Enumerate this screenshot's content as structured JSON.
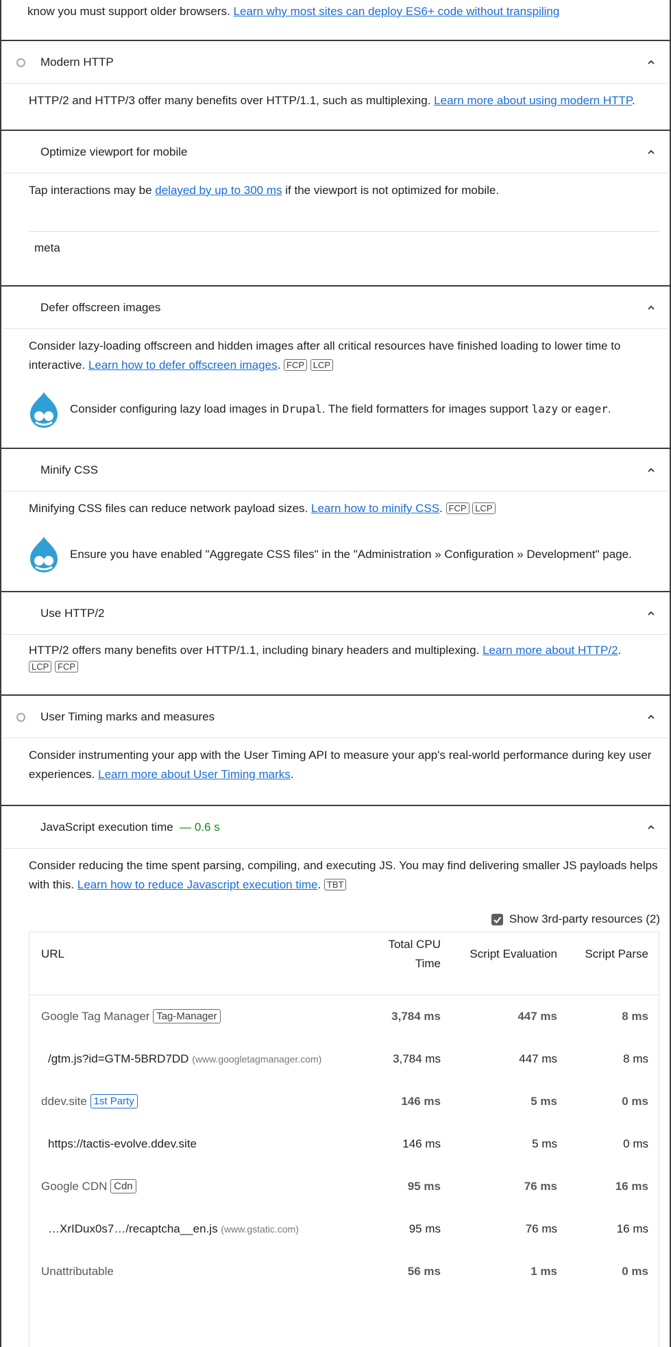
{
  "top": {
    "text": "know you must support older browsers.",
    "link": "Learn why most sites can deploy ES6+ code without transpiling"
  },
  "audits": [
    {
      "title": "Modern HTTP",
      "desc": "HTTP/2 and HTTP/3 offer many benefits over HTTP/1.1, such as multiplexing.",
      "link": "Learn more about using modern HTTP"
    },
    {
      "title": "Optimize viewport for mobile",
      "desc_pre": "Tap interactions may be",
      "link": "delayed by up to 300 ms",
      "desc_post": "if the viewport is not optimized for mobile.",
      "node": "meta"
    },
    {
      "title": "Defer offscreen images",
      "desc": "Consider lazy-loading offscreen and hidden images after all critical resources have finished loading to lower time to interactive.",
      "link": "Learn how to defer offscreen images",
      "chips": [
        "FCP",
        "LCP"
      ],
      "hint_pre": "Consider configuring lazy load images in",
      "hint_code1": "Drupal",
      "hint_mid": ". The field formatters for images support",
      "hint_code2": "lazy",
      "hint_or": "or",
      "hint_code3": "eager"
    },
    {
      "title": "Minify CSS",
      "desc": "Minifying CSS files can reduce network payload sizes.",
      "link": "Learn how to minify CSS",
      "chips": [
        "FCP",
        "LCP"
      ],
      "hint": "Ensure you have enabled \"Aggregate CSS files\" in the \"Administration » Configuration » Development\" page."
    },
    {
      "title": "Use HTTP/2",
      "desc": "HTTP/2 offers many benefits over HTTP/1.1, including binary headers and multiplexing.",
      "link": "Learn more about HTTP/2",
      "chips": [
        "LCP",
        "FCP"
      ]
    },
    {
      "title": "User Timing marks and measures",
      "desc": "Consider instrumenting your app with the User Timing API to measure your app's real-world performance during key user experiences.",
      "link": "Learn more about User Timing marks"
    },
    {
      "title": "JavaScript execution time",
      "value": "— 0.6 s",
      "desc": "Consider reducing the time spent parsing, compiling, and executing JS. You may find delivering smaller JS payloads helps with this.",
      "link": "Learn how to reduce Javascript execution time",
      "chips": [
        "TBT"
      ],
      "third_party_label": "Show 3rd-party resources (2)",
      "third_party_checked": true
    }
  ],
  "table": {
    "headers": {
      "url": "URL",
      "cpu_line1": "Total CPU",
      "cpu_line2": "Time",
      "eval": "Script Evaluation",
      "parse": "Script Parse"
    },
    "rows": [
      {
        "kind": "group",
        "name": "Google Tag Manager",
        "badge": "Tag-Manager",
        "cpu": "3,784 ms",
        "eval": "447 ms",
        "parse": "8 ms"
      },
      {
        "kind": "item",
        "url": "/gtm.js?id=GTM-5BRD7DD",
        "host": "(www.googletagmanager.com)",
        "cpu": "3,784 ms",
        "eval": "447 ms",
        "parse": "8 ms"
      },
      {
        "kind": "group",
        "name": "ddev.site",
        "badge": "1st Party",
        "cpu": "146 ms",
        "eval": "5 ms",
        "parse": "0 ms"
      },
      {
        "kind": "item",
        "url": "https://tactis-evolve.ddev.site",
        "host": "",
        "cpu": "146 ms",
        "eval": "5 ms",
        "parse": "0 ms"
      },
      {
        "kind": "group",
        "name": "Google CDN",
        "badge": "Cdn",
        "cpu": "95 ms",
        "eval": "76 ms",
        "parse": "16 ms"
      },
      {
        "kind": "item",
        "url": "…XrIDux0s7…/recaptcha__en.js",
        "host": "(www.gstatic.com)",
        "cpu": "95 ms",
        "eval": "76 ms",
        "parse": "16 ms"
      },
      {
        "kind": "group",
        "name": "Unattributable",
        "badge": "",
        "cpu": "56 ms",
        "eval": "1 ms",
        "parse": "0 ms"
      }
    ]
  }
}
